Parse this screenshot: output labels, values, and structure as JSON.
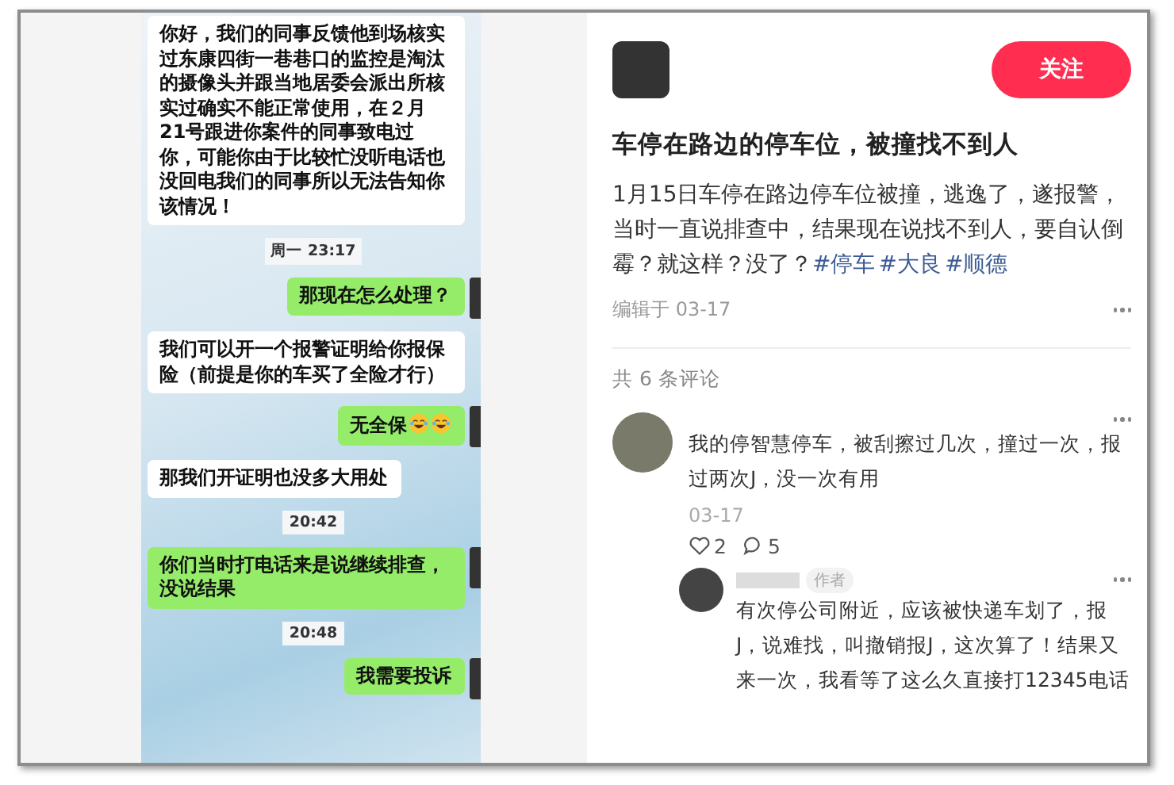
{
  "chat": {
    "messages": [
      {
        "kind": "incoming",
        "text": "你好，我们的同事反馈他到场核实过东康四街一巷巷口的监控是淘汰的摄像头并跟当地居委会派出所核实过确实不能正常使用，在２月21号跟进你案件的同事致电过你，可能你由于比较忙没听电话也没回电我们的同事所以无法告知你该情况！"
      },
      {
        "kind": "time",
        "text": "周一 23:17"
      },
      {
        "kind": "outgoing",
        "text": "那现在怎么处理？"
      },
      {
        "kind": "incoming",
        "text": "我们可以开一个报警证明给你报保险（前提是你的车买了全险才行）"
      },
      {
        "kind": "outgoing",
        "text": "无全保",
        "emoji": [
          {
            "kind": "laughing"
          },
          {
            "kind": "laughing"
          }
        ]
      },
      {
        "kind": "incoming",
        "text": "那我们开证明也没多大用处"
      },
      {
        "kind": "time",
        "text": "20:42"
      },
      {
        "kind": "outgoing",
        "text": "你们当时打电话来是说继续排查，没说结果"
      },
      {
        "kind": "time",
        "text": "20:48"
      },
      {
        "kind": "outgoing",
        "text": "我需要投诉"
      }
    ]
  },
  "post": {
    "follow_button": "关注",
    "title": "车停在路边的停车位，被撞找不到人",
    "body": "1月15日车停在路边停车位被撞，逃逸了，遂报警，当时一直说排查中，结果现在说找不到人，要自认倒霉？就这样？没了？",
    "tags": [
      "#停车",
      "#大良",
      "#顺德"
    ],
    "edited": "编辑于 03-17"
  },
  "comments": {
    "count_label": "共 6 条评论",
    "items": [
      {
        "text": "我的停智慧停车，被刮擦过几次，撞过一次，报过两次J，没一次有用",
        "date": "03-17",
        "likes": "2",
        "replies_count": "5",
        "replies": [
          {
            "badge": "作者",
            "text": "有次停公司附近，应该被快递车划了，报J，说难找，叫撤销报J，这次算了！结果又来一次，我看等了这么久直接打12345电话"
          }
        ]
      }
    ]
  }
}
